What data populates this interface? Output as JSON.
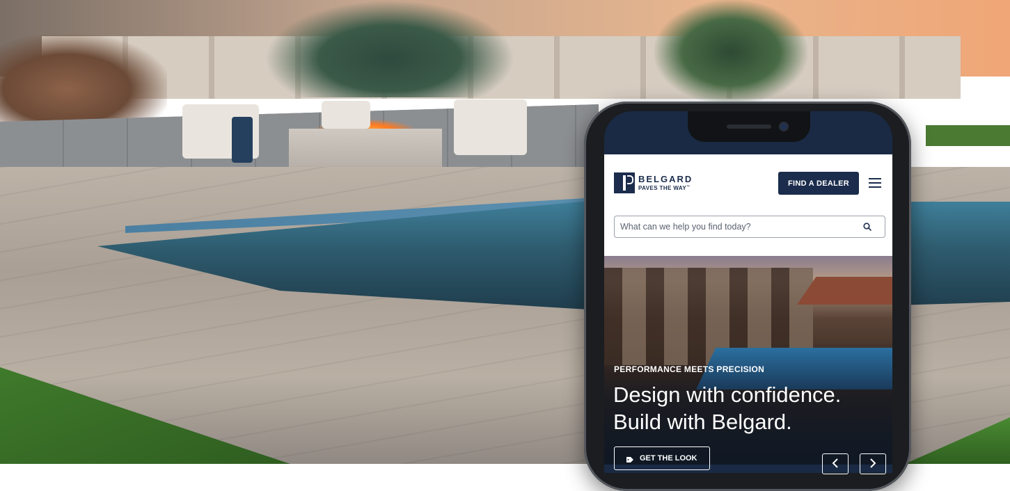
{
  "site": {
    "brand_name": "BELGARD",
    "brand_tagline": "PAVES THE WAY",
    "trademark": "™",
    "header_button": "FIND A DEALER",
    "menu_icon": "hamburger-menu-icon"
  },
  "search": {
    "placeholder": "What can we help you find today?",
    "icon": "search-icon"
  },
  "hero": {
    "eyebrow": "PERFORMANCE MEETS PRECISION",
    "headline_line1": "Design with confidence.",
    "headline_line2": "Build with Belgard.",
    "cta_label": "GET THE LOOK",
    "cta_icon": "tag-icon",
    "prev_icon": "chevron-left-icon",
    "next_icon": "chevron-right-icon"
  },
  "colors": {
    "brand_navy": "#1b2c4c",
    "header_background": "#ffffff",
    "hero_text": "#ffffff"
  }
}
